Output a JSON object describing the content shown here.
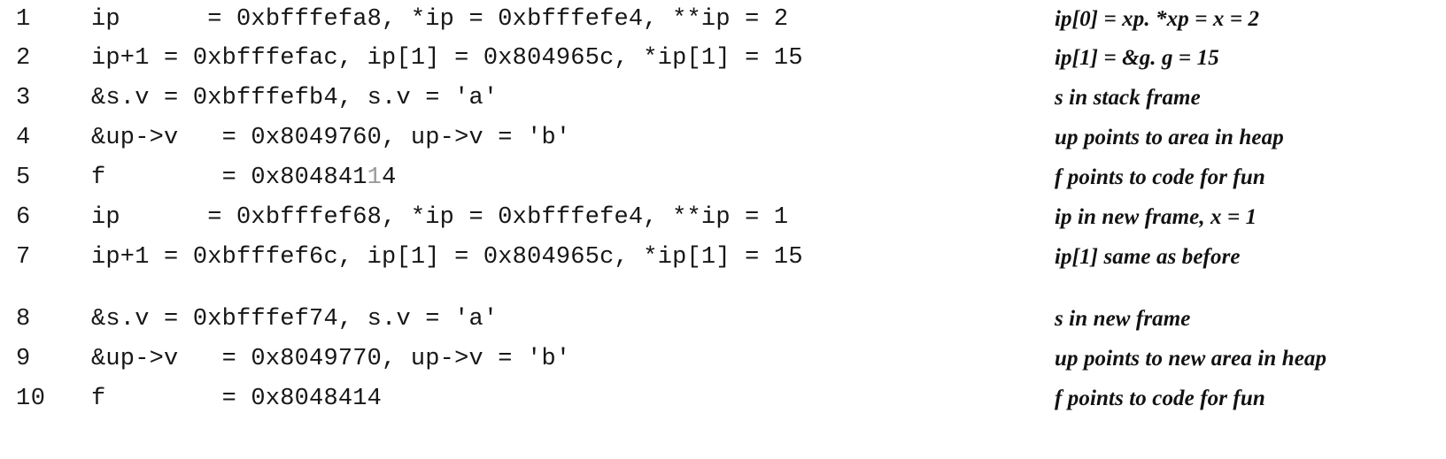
{
  "figure": {
    "kind": "pointer-trace-listing",
    "row_count": 10,
    "colors": {
      "ink": "#161616",
      "page": "#ffffff",
      "faded_ink": "#9a9a9a"
    },
    "columns": {
      "line_number_header": "",
      "code_header": "",
      "annotation_header": ""
    },
    "rows": [
      {
        "num": "1",
        "code": "ip      = 0xbfffefa8, *ip = 0xbfffefe4, **ip = 2",
        "note": "ip[0] = xp. *xp = x = 2"
      },
      {
        "num": "2",
        "code": "ip+1 = 0xbfffefac, ip[1] = 0x804965c, *ip[1] = 15",
        "note": "ip[1] = &g. g = 15"
      },
      {
        "num": "3",
        "code": "&s.v = 0xbfffefb4, s.v = 'a'",
        "note": "s in stack frame"
      },
      {
        "num": "4",
        "code": "&up->v   = 0x8049760, up->v = 'b'",
        "note": "up points to area in heap"
      },
      {
        "num": "5",
        "code_prefix": "f        = 0x804841",
        "code_faded": "1",
        "code_suffix": "4",
        "code": "f        = 0x80484‑4",
        "note": "f points to code for fun"
      },
      {
        "num": "6",
        "code": "ip      = 0xbfffef68, *ip = 0xbfffefe4, **ip = 1",
        "note": "ip in new frame, x = 1"
      },
      {
        "num": "7",
        "code": "ip+1 = 0xbfffef6c, ip[1] = 0x804965c, *ip[1] = 15",
        "note": "ip[1] same as before"
      },
      {
        "num": "8",
        "code": "&s.v = 0xbfffef74, s.v = 'a'",
        "note": "s in new frame"
      },
      {
        "num": "9",
        "code": "&up->v   = 0x8049770, up->v = 'b'",
        "note": "up points to new area in heap"
      },
      {
        "num": "10",
        "code": "f        = 0x8048414",
        "note": "f points to code for fun"
      }
    ]
  }
}
